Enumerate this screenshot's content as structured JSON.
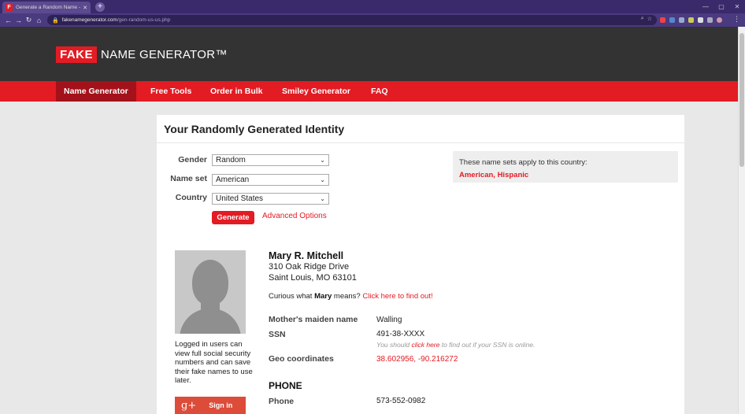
{
  "browser": {
    "tab_icon": "F",
    "tab_title": "Generate a Random Name - Fake",
    "url_host": "fakenamegenerator.com",
    "url_path": "/gen-random-us-us.php"
  },
  "site": {
    "logo_fake": "FAKE",
    "logo_rest": "NAME GENERATOR™",
    "nav": [
      "Name Generator",
      "Free Tools",
      "Order in Bulk",
      "Smiley Generator",
      "FAQ"
    ],
    "colors": {
      "brand": "#e31b23",
      "header": "#333333",
      "nav_active": "#a3121a"
    }
  },
  "page": {
    "heading": "Your Randomly Generated Identity",
    "form": {
      "gender_label": "Gender",
      "gender_value": "Random",
      "nameset_label": "Name set",
      "nameset_value": "American",
      "country_label": "Country",
      "country_value": "United States",
      "generate_label": "Generate",
      "advanced_label": "Advanced Options"
    },
    "country_info": {
      "text": "These name sets apply to this country:",
      "sets": "American, Hispanic"
    },
    "identity": {
      "name": "Mary R. Mitchell",
      "address_line1": "310 Oak Ridge Drive",
      "address_line2": "Saint Louis, MO 63101",
      "curious_prefix": "Curious what",
      "curious_name": "Mary",
      "curious_mid": "means?",
      "curious_link": "Click here to find out!",
      "maiden_label": "Mother's maiden name",
      "maiden_value": "Walling",
      "ssn_label": "SSN",
      "ssn_value": "491-38-XXXX",
      "ssn_note_prefix": "You should",
      "ssn_note_link": "click here",
      "ssn_note_suffix": "to find out if your SSN is online.",
      "geo_label": "Geo coordinates",
      "geo_value": "38.602956, -90.216272",
      "phone_section": "PHONE",
      "phone_label": "Phone",
      "phone_value": "573-552-0982"
    },
    "sidebar": {
      "logged_text": "Logged in users can view full social security numbers and can save their fake names to use later.",
      "gplus_icon": "g+",
      "signin_label": "Sign in"
    }
  }
}
